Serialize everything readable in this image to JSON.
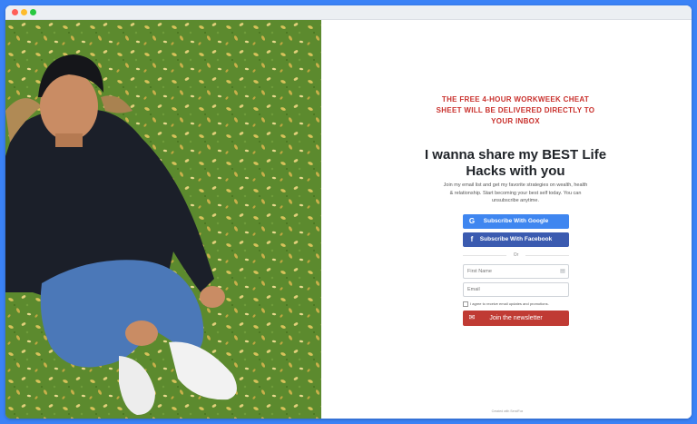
{
  "window": {
    "controls": [
      "close",
      "minimize",
      "maximize"
    ]
  },
  "photo": {
    "subject": "person-sitting-on-grass"
  },
  "content": {
    "tagline": "THE FREE 4-HOUR WORKWEEK CHEAT SHEET WILL BE DELIVERED DIRECTLY TO YOUR INBOX",
    "headline": "I wanna share my BEST Life Hacks with you",
    "subtext": "Join my email list and get my favorite strategies on wealth, health & relationship. Start becoming your best self today. You can unsubscribe anytime.",
    "google_button": "Subscribe With Google",
    "facebook_button": "Subscribe With Facebook",
    "or_label": "Or",
    "first_name_placeholder": "First Name",
    "email_placeholder": "Email",
    "consent_text": "I agree to receive email updates and promotions.",
    "join_button": "Join the newsletter",
    "footer": "Created with  SendFox"
  },
  "icons": {
    "google": "google-icon",
    "facebook": "facebook-icon",
    "email": "envelope-icon",
    "contact": "contact-card-icon"
  },
  "colors": {
    "tagline": "#c9302c",
    "google": "#3f86f0",
    "facebook": "#3b5bb0",
    "join": "#c03b34",
    "frame": "#3b82f6"
  }
}
